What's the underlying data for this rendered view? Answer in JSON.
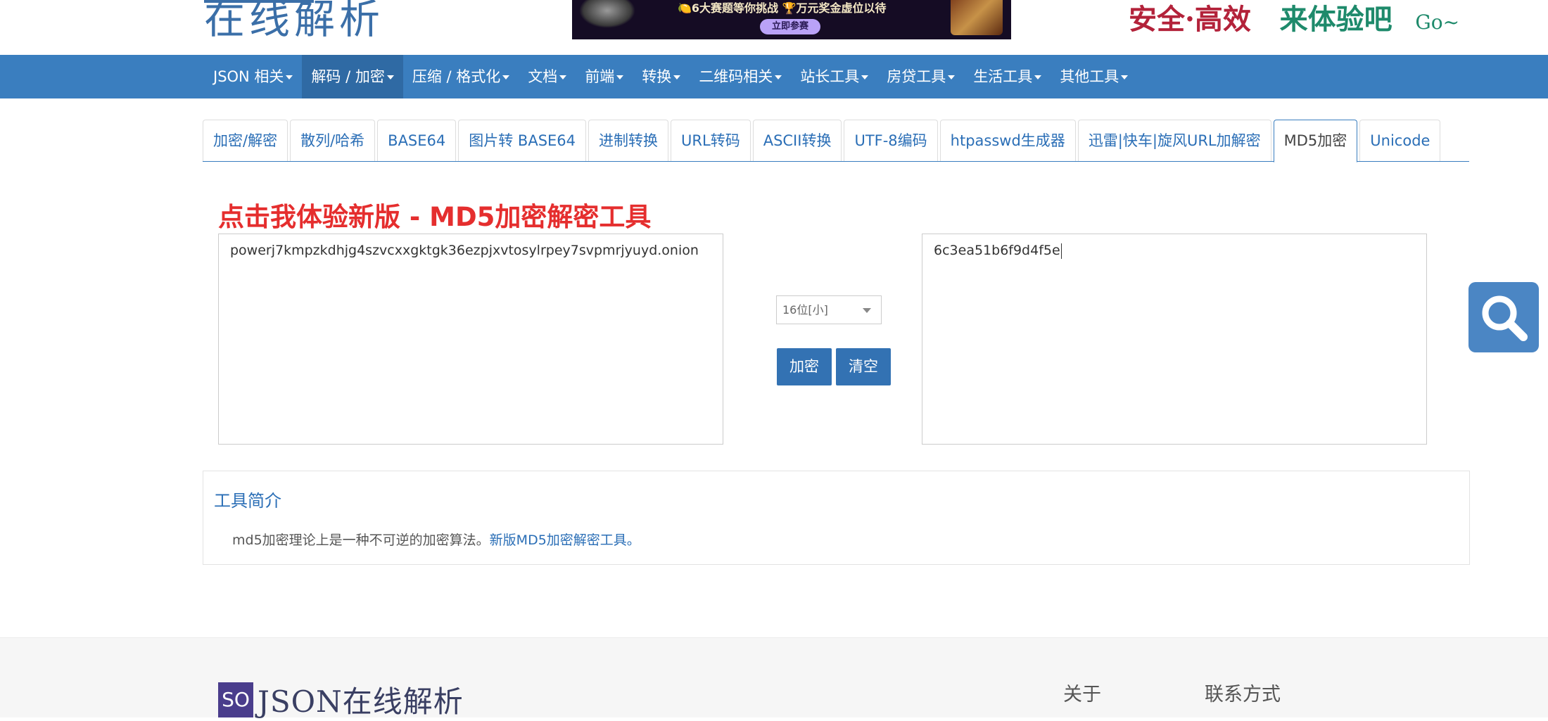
{
  "header": {
    "logo_text": "在线解析",
    "banner": {
      "text": "🍋6大赛题等你挑战  🏆万元奖金虚位以待",
      "button": "立即参赛"
    },
    "slogan": {
      "part1": "安全·高效",
      "part2": "来体验吧",
      "part3": "Go~"
    }
  },
  "nav": {
    "items": [
      {
        "label": "JSON 相关"
      },
      {
        "label": "解码 / 加密",
        "active": true
      },
      {
        "label": "压缩 / 格式化"
      },
      {
        "label": "文档"
      },
      {
        "label": "前端"
      },
      {
        "label": "转换"
      },
      {
        "label": "二维码相关"
      },
      {
        "label": "站长工具"
      },
      {
        "label": "房贷工具"
      },
      {
        "label": "生活工具"
      },
      {
        "label": "其他工具"
      }
    ]
  },
  "tabs": [
    {
      "label": "加密/解密"
    },
    {
      "label": "散列/哈希"
    },
    {
      "label": "BASE64"
    },
    {
      "label": "图片转 BASE64"
    },
    {
      "label": "进制转换"
    },
    {
      "label": "URL转码"
    },
    {
      "label": "ASCII转换"
    },
    {
      "label": "UTF-8编码"
    },
    {
      "label": "htpasswd生成器"
    },
    {
      "label": "迅雷|快车|旋风URL加解密"
    },
    {
      "label": "MD5加密",
      "active": true
    },
    {
      "label": "Unicode"
    }
  ],
  "main": {
    "promo": "点击我体验新版 - MD5加密解密工具",
    "input_value": "powerj7kmpzkdhjg4szvcxxgktgk36ezpjxvtosylrpey7svpmrjyuyd.onion",
    "output_value": "6c3ea51b6f9d4f5e",
    "bit_select": "16位[小]",
    "encrypt_button": "加密",
    "clear_button": "清空"
  },
  "intro": {
    "title": "工具简介",
    "text": "md5加密理论上是一种不可逆的加密算法。",
    "link": "新版MD5加密解密工具。"
  },
  "footer": {
    "logo_badge": "SO",
    "logo_name": "JSON在线解析",
    "about": "关于",
    "contact": "联系方式"
  },
  "colors": {
    "nav_bg": "#3a7ebf",
    "button_bg": "#3372b3",
    "promo_red": "#e52e2e",
    "link_blue": "#2a6eb6"
  }
}
